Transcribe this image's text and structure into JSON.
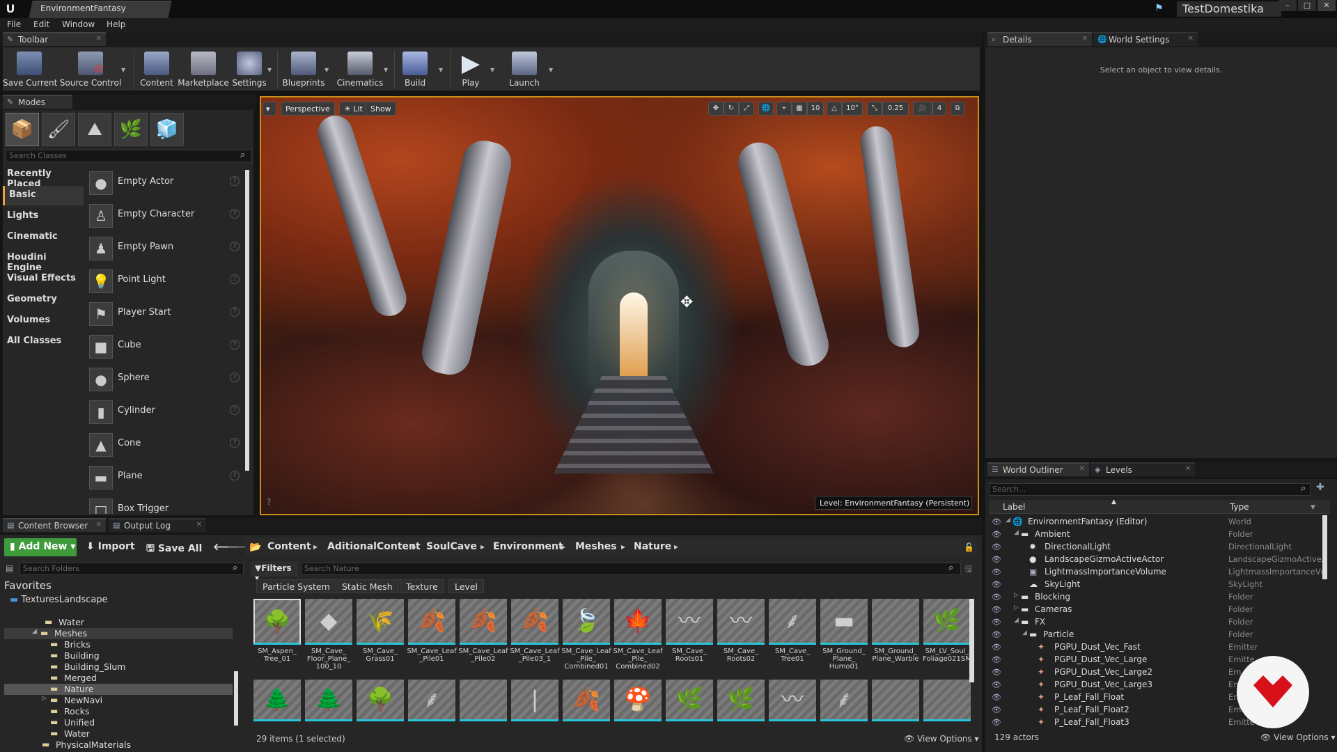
{
  "window": {
    "doc_tab": "EnvironmentFantasy",
    "project": "TestDomestika"
  },
  "menu": [
    "File",
    "Edit",
    "Window",
    "Help"
  ],
  "toolbar": {
    "tab": "Toolbar",
    "buttons": [
      "Save Current",
      "Source Control",
      "Content",
      "Marketplace",
      "Settings",
      "Blueprints",
      "Cinematics",
      "Build",
      "Play",
      "Launch"
    ]
  },
  "modes": {
    "tab": "Modes",
    "search_placeholder": "Search Classes",
    "categories": [
      "Recently Placed",
      "Basic",
      "Lights",
      "Cinematic",
      "Houdini Engine",
      "Visual Effects",
      "Geometry",
      "Volumes",
      "All Classes"
    ],
    "selected_category": "Basic",
    "items": [
      "Empty Actor",
      "Empty Character",
      "Empty Pawn",
      "Point Light",
      "Player Start",
      "Cube",
      "Sphere",
      "Cylinder",
      "Cone",
      "Plane",
      "Box Trigger"
    ]
  },
  "viewport": {
    "perspective": "Perspective",
    "lit": "Lit",
    "show": "Show",
    "grid_snap": "10",
    "rot_snap": "10°",
    "scale_snap": "0.25",
    "cam_speed": "4",
    "level_label": "Level:  EnvironmentFantasy (Persistent)"
  },
  "details": {
    "tab1": "Details",
    "tab2": "World Settings",
    "empty_msg": "Select an object to view details."
  },
  "outliner": {
    "tab1": "World Outliner",
    "tab2": "Levels",
    "search_placeholder": "Search...",
    "col_label": "Label",
    "col_type": "Type",
    "rows": [
      {
        "label": "EnvironmentFantasy (Editor)",
        "type": "World"
      },
      {
        "label": "Ambient",
        "type": "Folder"
      },
      {
        "label": "DirectionalLight",
        "type": "DirectionalLight"
      },
      {
        "label": "LandscapeGizmoActiveActor",
        "type": "LandscapeGizmoActive/"
      },
      {
        "label": "LightmassImportanceVolume",
        "type": "LightmassImportanceVc"
      },
      {
        "label": "SkyLight",
        "type": "SkyLight"
      },
      {
        "label": "Blocking",
        "type": "Folder"
      },
      {
        "label": "Cameras",
        "type": "Folder"
      },
      {
        "label": "FX",
        "type": "Folder"
      },
      {
        "label": "Particle",
        "type": "Folder"
      },
      {
        "label": "PGPU_Dust_Vec_Fast",
        "type": "Emitter"
      },
      {
        "label": "PGPU_Dust_Vec_Large",
        "type": "Emitte"
      },
      {
        "label": "PGPU_Dust_Vec_Large2",
        "type": "Em"
      },
      {
        "label": "PGPU_Dust_Vec_Large3",
        "type": "Em"
      },
      {
        "label": "P_Leaf_Fall_Float",
        "type": "Em"
      },
      {
        "label": "P_Leaf_Fall_Float2",
        "type": "Em"
      },
      {
        "label": "P_Leaf_Fall_Float3",
        "type": "Emitte"
      }
    ],
    "actor_count": "129 actors",
    "view_options": "View Options"
  },
  "content_browser": {
    "tab1": "Content Browser",
    "tab2": "Output Log",
    "add_new": "Add New",
    "import": "Import",
    "save_all": "Save All",
    "breadcrumb": [
      "Content",
      "AditionalContent",
      "SoulCave",
      "Environment",
      "Meshes",
      "Nature"
    ],
    "search_folders": "Search Folders",
    "filters": "Filters",
    "search_assets": "Search Nature",
    "filter_tabs": [
      "Particle System",
      "Static Mesh",
      "Texture",
      "Level"
    ],
    "favorites_title": "Favorites",
    "favorite_item": "TexturesLandscape",
    "folders": [
      "Water",
      "Meshes",
      "Bricks",
      "Building",
      "Building_Slum",
      "Merged",
      "Nature",
      "NewNavi",
      "Rocks",
      "Unified",
      "Water",
      "PhysicalMaterials"
    ],
    "assets": [
      "SM_Aspen_ Tree_01",
      "SM_Cave_ Floor_Plane_ 100_10",
      "SM_Cave_ Grass01",
      "SM_Cave_Leaf _Pile01",
      "SM_Cave_Leaf _Pile02",
      "SM_Cave_Leaf _Pile03_1",
      "SM_Cave_Leaf _Pile_ Combined01",
      "SM_Cave_Leaf _Pile_ Combined02",
      "SM_Cave_ Roots01",
      "SM_Cave_ Roots02",
      "SM_Cave_ Tree01",
      "SM_Ground_ Plane_ Humo01",
      "SM_Ground_ Plane_Warble",
      "SM_LV_Soul_ Foliage021SM"
    ],
    "item_count": "29 items (1 selected)",
    "view_options": "View Options"
  }
}
